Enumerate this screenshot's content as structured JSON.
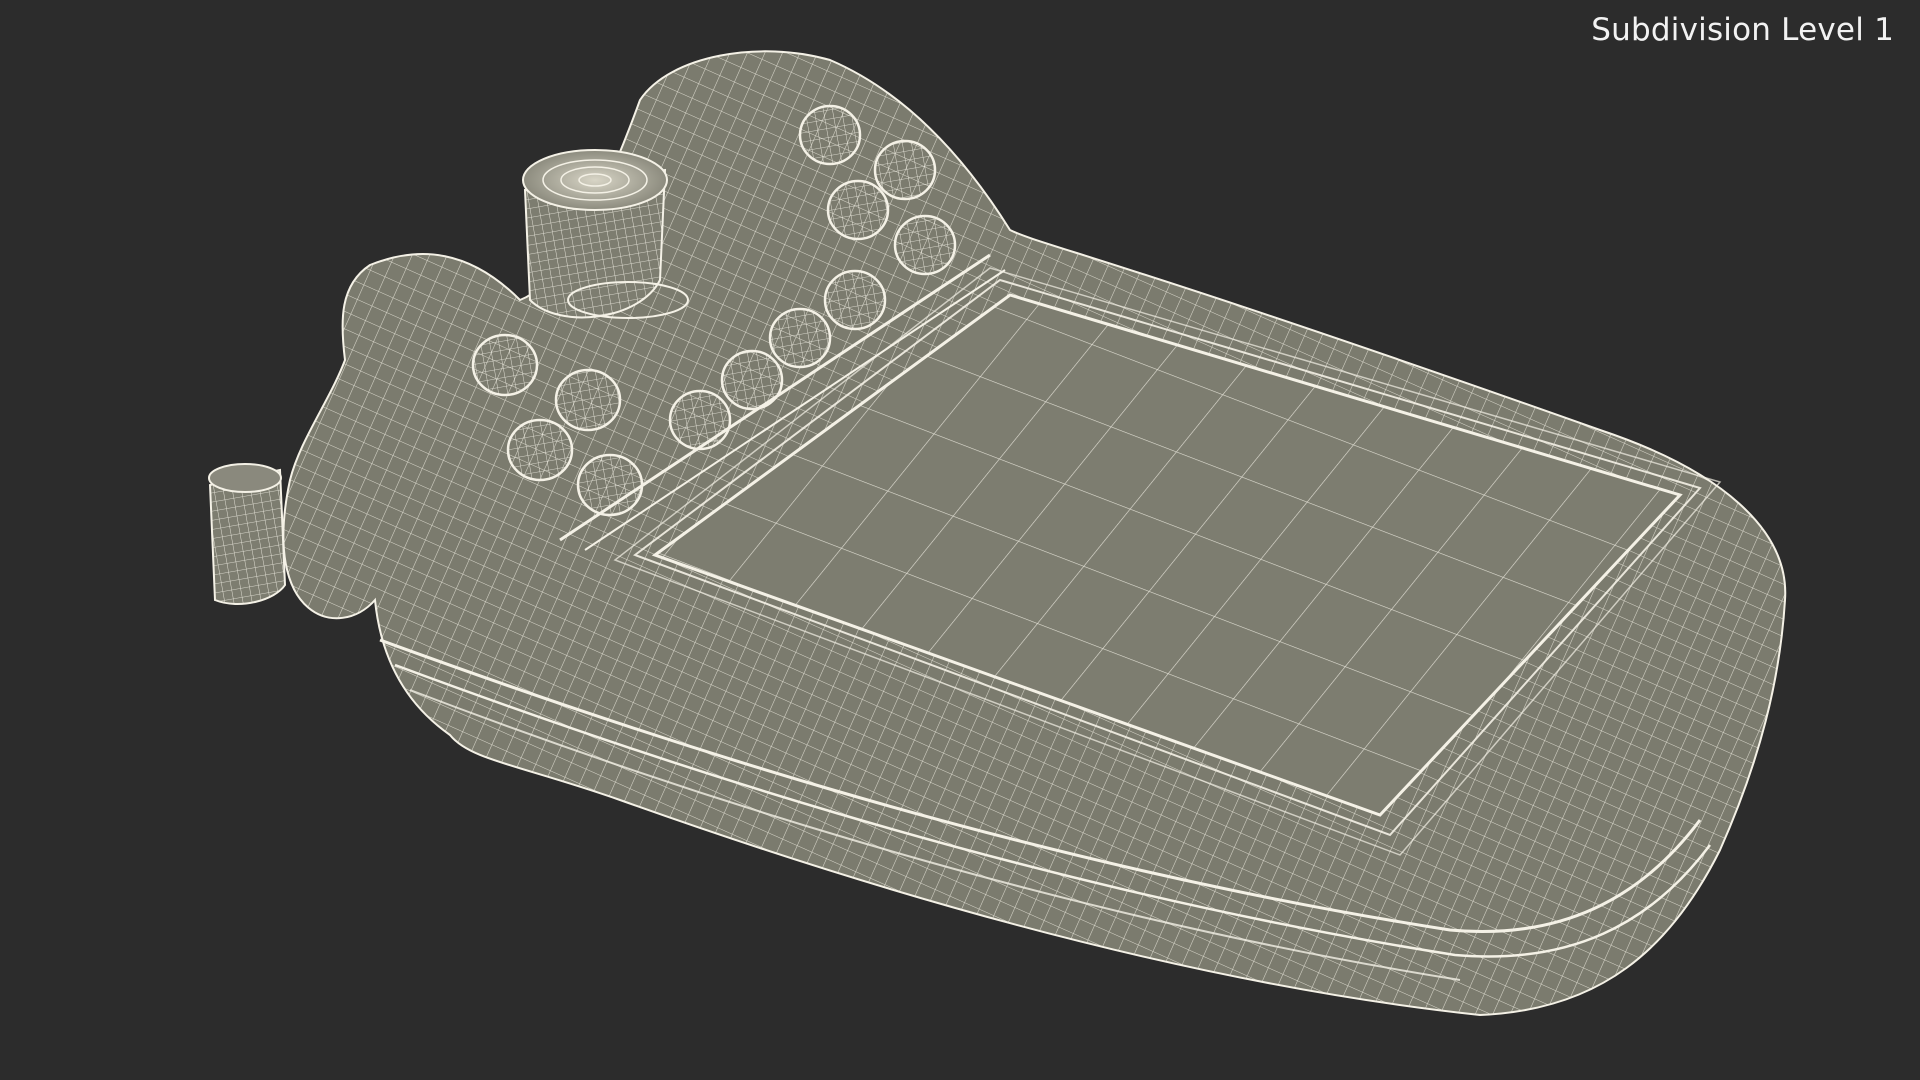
{
  "viewport": {
    "subdivision_label": "Subdivision Level 1",
    "background_color": "#2c2c2c",
    "wire_color": "#f4f1e6",
    "surface_color": "#7b7b6e"
  }
}
